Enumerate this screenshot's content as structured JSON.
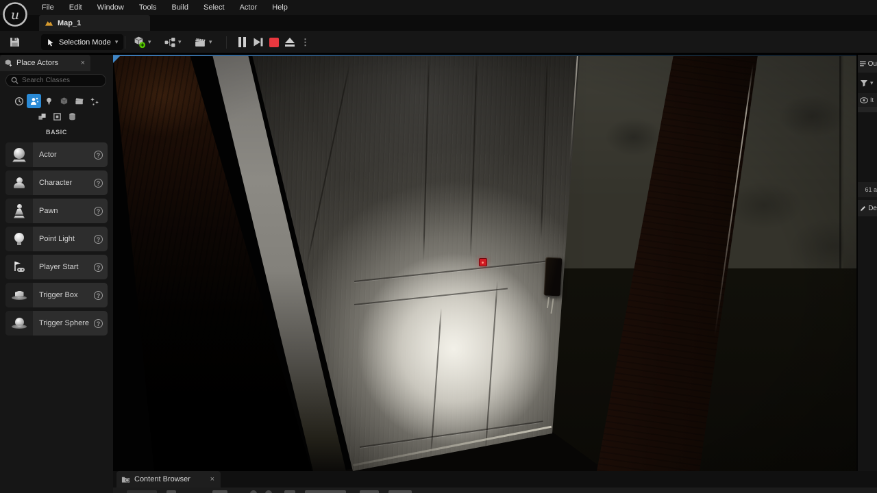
{
  "menubar": {
    "items": [
      "File",
      "Edit",
      "Window",
      "Tools",
      "Build",
      "Select",
      "Actor",
      "Help"
    ]
  },
  "level_tab": {
    "label": "Map_1"
  },
  "toolbar": {
    "selection_mode": "Selection Mode"
  },
  "glyphs": {
    "chevron": "▾",
    "close": "×",
    "help": "?",
    "dots": "⋮",
    "question": "?"
  },
  "place_actors": {
    "title": "Place Actors",
    "search_placeholder": "Search Classes",
    "section_label": "BASIC",
    "items": [
      {
        "label": "Actor"
      },
      {
        "label": "Character"
      },
      {
        "label": "Pawn"
      },
      {
        "label": "Point Light"
      },
      {
        "label": "Player Start"
      },
      {
        "label": "Trigger Box"
      },
      {
        "label": "Trigger Sphere"
      }
    ]
  },
  "outliner_strip": {
    "tab_label": "Ou",
    "column_label": "It",
    "count_label": "61 a",
    "details_label": "De"
  },
  "bottom_dock": {
    "content_browser_label": "Content Browser"
  },
  "colors": {
    "accent_blue": "#2a8ad6",
    "stop_red": "#e8383f",
    "sprite_red": "#d01a22",
    "viewport_focus_blue": "#3f86c6"
  }
}
